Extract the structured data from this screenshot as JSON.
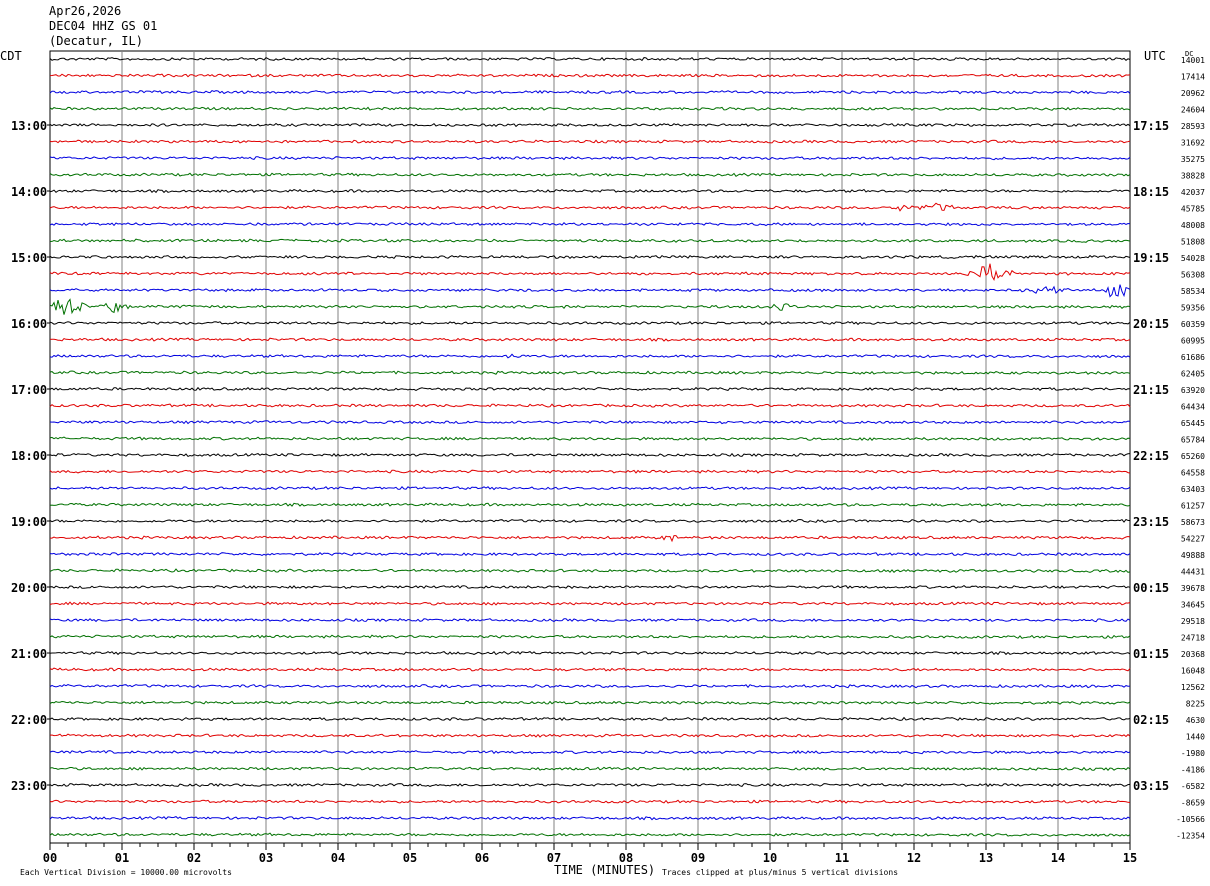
{
  "header": {
    "date": "Apr26,2026",
    "station": "DEC04 HHZ GS 01",
    "location": "(Decatur, IL)"
  },
  "left_timezone": "CDT",
  "right_timezone": "UTC",
  "dc_label": "DC",
  "footer": {
    "division_note": "Each Vertical Division = 10000.00 microvolts",
    "clip_note": "Traces clipped at plus/minus 5 vertical divisions"
  },
  "colors": {
    "trace_cycle": [
      "#000000",
      "#e00000",
      "#0000e0",
      "#007000"
    ],
    "grid": "#808080"
  },
  "chart_data": {
    "type": "line",
    "title": "DEC04 HHZ GS 01",
    "xlabel": "TIME (MINUTES)",
    "x_ticks": [
      "00",
      "01",
      "02",
      "03",
      "04",
      "05",
      "06",
      "07",
      "08",
      "09",
      "10",
      "11",
      "12",
      "13",
      "14",
      "15"
    ],
    "xlim": [
      0,
      15
    ],
    "rows_per_hour": 4,
    "left_hour_labels": [
      "13:00",
      "14:00",
      "15:00",
      "16:00",
      "17:00",
      "18:00",
      "19:00",
      "20:00",
      "21:00",
      "22:00",
      "23:00"
    ],
    "right_hour_labels": [
      "17:15",
      "18:15",
      "19:15",
      "20:15",
      "21:15",
      "22:15",
      "23:15",
      "00:15",
      "01:15",
      "02:15",
      "03:15"
    ],
    "dc_offsets": [
      "14001",
      "17414",
      "20962",
      "24604",
      "28593",
      "31692",
      "35275",
      "38828",
      "42037",
      "45785",
      "48008",
      "51808",
      "54028",
      "56308",
      "58534",
      "59356",
      "60359",
      "60995",
      "61686",
      "62405",
      "63920",
      "64434",
      "65445",
      "65784",
      "65260",
      "64558",
      "63403",
      "61257",
      "58673",
      "54227",
      "49888",
      "44431",
      "39678",
      "34645",
      "29518",
      "24718",
      "20368",
      "16048",
      "12562",
      "8225",
      "4630",
      "1440",
      "-1980",
      "-4186",
      "-6582",
      "-8659",
      "-10566",
      "-12354"
    ],
    "events": [
      {
        "row": 13,
        "minute": 13.08,
        "amplitude": 1.4,
        "width": 0.5
      },
      {
        "row": 14,
        "minute": 14.8,
        "amplitude": 1.1,
        "width": 0.35
      },
      {
        "row": 14,
        "minute": 13.8,
        "amplitude": 0.45,
        "width": 0.6
      },
      {
        "row": 15,
        "minute": 0.2,
        "amplitude": 1.2,
        "width": 0.5
      },
      {
        "row": 15,
        "minute": 0.9,
        "amplitude": 0.7,
        "width": 0.35
      },
      {
        "row": 15,
        "minute": 10.2,
        "amplitude": 0.5,
        "width": 0.3
      },
      {
        "row": 9,
        "minute": 12.3,
        "amplitude": 0.55,
        "width": 0.5
      },
      {
        "row": 9,
        "minute": 11.8,
        "amplitude": 0.35,
        "width": 0.3
      },
      {
        "row": 18,
        "minute": 6.4,
        "amplitude": 0.6,
        "width": 0.15
      },
      {
        "row": 29,
        "minute": 8.6,
        "amplitude": 0.45,
        "width": 0.3
      }
    ]
  }
}
